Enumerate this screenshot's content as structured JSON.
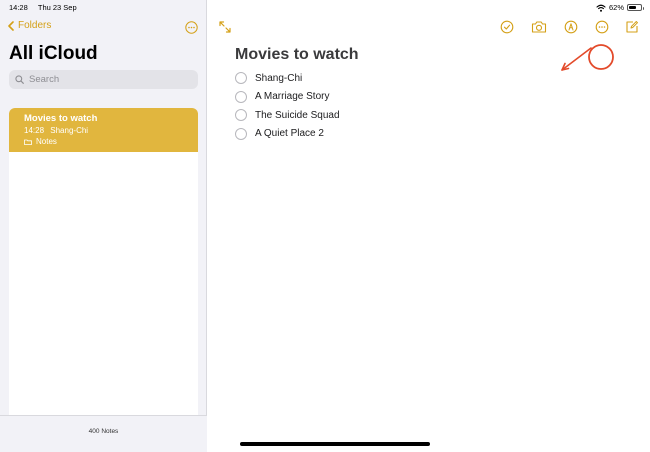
{
  "status": {
    "time": "14:28",
    "date": "Thu 23 Sep",
    "battery": "62%",
    "battery_level": 0.62
  },
  "sidebar": {
    "back_label": "Folders",
    "title": "All iCloud",
    "search_placeholder": "Search",
    "notes": [
      {
        "title": "Movies to watch",
        "time": "14:28",
        "preview": "Shang-Chi",
        "folder": "Notes",
        "selected": true
      }
    ],
    "notes_count": "400 Notes"
  },
  "note": {
    "title": "Movies to watch",
    "checklist": [
      {
        "text": "Shang-Chi",
        "checked": false
      },
      {
        "text": "A Marriage Story",
        "checked": false
      },
      {
        "text": "The Suicide Squad",
        "checked": false
      },
      {
        "text": "A Quiet Place 2",
        "checked": false
      }
    ]
  },
  "toolbar": {
    "icons": [
      "expand-icon",
      "checklist-icon",
      "camera-icon",
      "markup-icon",
      "more-icon",
      "compose-icon"
    ]
  },
  "colors": {
    "accent": "#d4a017",
    "selected_note": "#e1b63e",
    "annotation": "#e34a2a"
  }
}
